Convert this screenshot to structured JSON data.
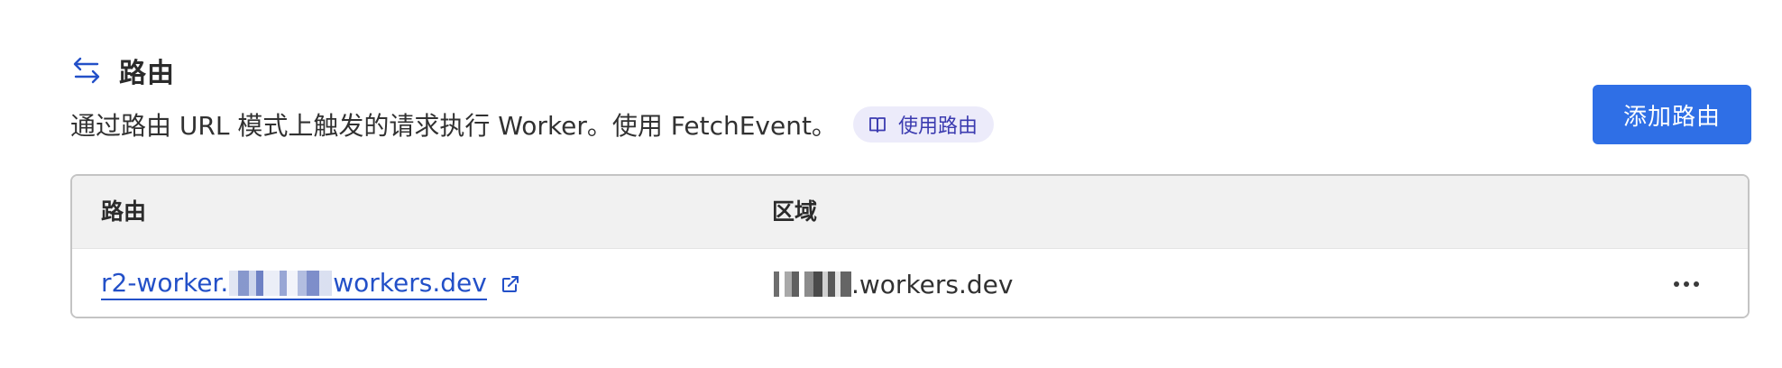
{
  "section": {
    "title": "路由",
    "icon": "arrows-left-right-icon",
    "description": "通过路由 URL 模式上触发的请求执行 Worker。使用 FetchEvent。",
    "docs_pill_label": "使用路由",
    "docs_pill_icon": "book-icon"
  },
  "actions": {
    "add_route_label": "添加路由"
  },
  "table": {
    "columns": [
      "路由",
      "区域"
    ],
    "rows": [
      {
        "route_prefix": "r2-worker.",
        "route_suffix": "workers.dev",
        "zone_suffix": ".workers.dev",
        "route_icon": "external-link-icon",
        "row_action_icon": "more-horizontal-icon"
      }
    ]
  },
  "colors": {
    "accent": "#2f6fe6",
    "link": "#2350c8",
    "pill_bg": "#ecebfa",
    "pill_text": "#3b3bb0",
    "header_bg": "#f1f1f1"
  }
}
